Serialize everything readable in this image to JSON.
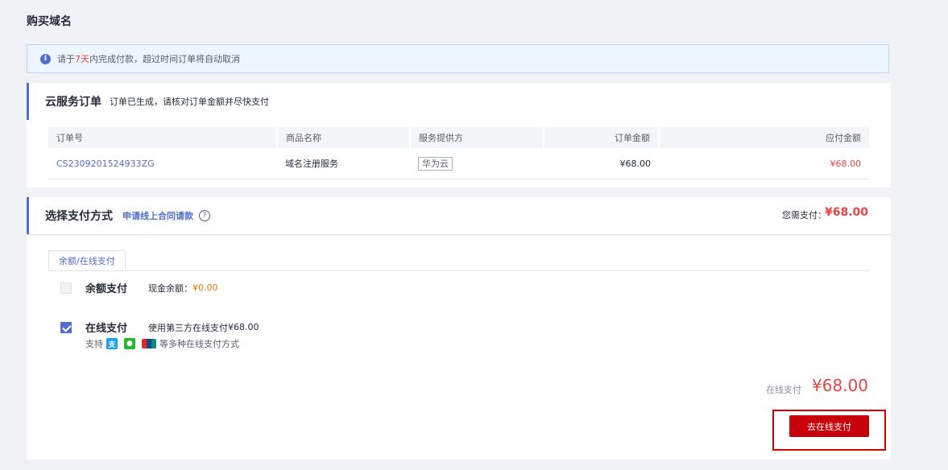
{
  "page": {
    "title": "购买域名"
  },
  "notice": {
    "prefix": "请于",
    "days": "7天",
    "suffix": "内完成付款，超过时间订单将自动取消"
  },
  "order": {
    "title": "云服务订单",
    "subtitle": "订单已生成，请核对订单金额并尽快支付",
    "columns": [
      "订单号",
      "商品名称",
      "服务提供方",
      "订单金额",
      "应付金额"
    ],
    "row": {
      "order_no": "CS2309201524933ZG",
      "product": "域名注册服务",
      "provider": "华为云",
      "amount": "¥68.00",
      "payable": "¥68.00"
    }
  },
  "payment": {
    "title": "选择支付方式",
    "contract_link": "申请线上合同请款",
    "total_label": "您需支付：",
    "total_amount": "¥68.00",
    "tab": "余额/在线支付",
    "balance": {
      "name": "余额支付",
      "desc": "现金余额：",
      "value": "¥0.00",
      "checked": false
    },
    "online": {
      "name": "在线支付",
      "desc": "使用第三方在线支付",
      "value": "¥68.00",
      "checked": true,
      "support_prefix": "支持",
      "support_suffix": "等多种在线支付方式"
    },
    "online_label": "在线支付",
    "online_amount": "¥68.00",
    "button": "去在线支付"
  },
  "colors": {
    "accent": "#526ecc",
    "price": "#e54545",
    "button": "#c7000b"
  }
}
